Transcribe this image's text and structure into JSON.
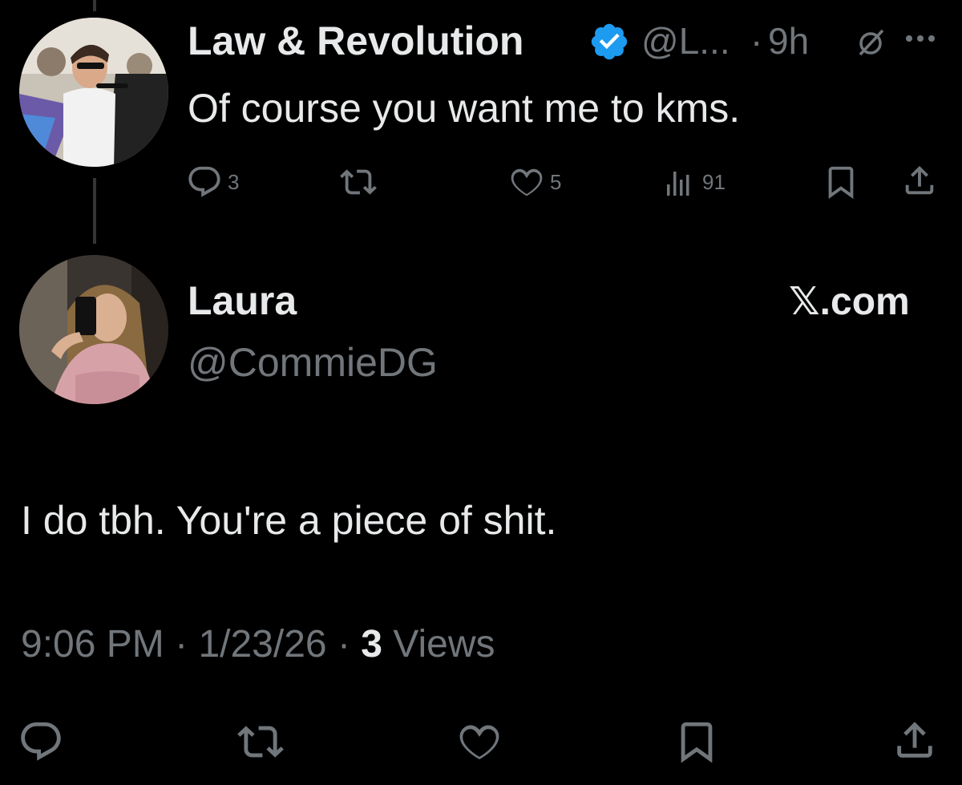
{
  "parent_tweet": {
    "author_name": "Law & Revolution",
    "handle": "@L...",
    "separator": "·",
    "time": "9h",
    "verified": true,
    "text": "Of course you want me to kms.",
    "actions": {
      "replies": "3",
      "likes": "5",
      "views": "91"
    }
  },
  "reply_tweet": {
    "author_name": "Laura",
    "handle": "@CommieDG",
    "logo_text": "𝕏.com",
    "text": "I do tbh. You're a piece of shit.",
    "time": "9:06 PM",
    "sep1": "·",
    "date": "1/23/26",
    "sep2": "·",
    "views_count": "3",
    "views_label": "Views"
  },
  "colors": {
    "accent": "#1d9bf0",
    "muted": "#71767b",
    "text": "#e7e9ea",
    "background": "#000000"
  },
  "icons": [
    "reply-icon",
    "retweet-icon",
    "like-icon",
    "views-icon",
    "bookmark-icon",
    "share-icon",
    "verified-badge-icon",
    "grok-icon",
    "more-icon"
  ]
}
